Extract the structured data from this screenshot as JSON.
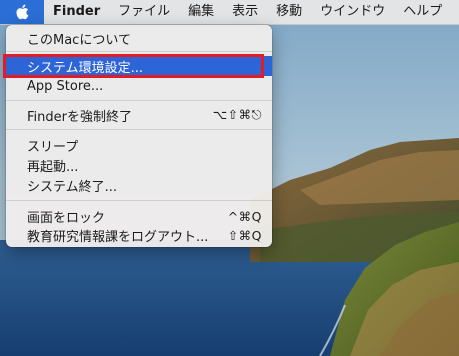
{
  "menubar": {
    "apple_icon": "apple-logo-icon",
    "app_name": "Finder",
    "menus": [
      "ファイル",
      "編集",
      "表示",
      "移動",
      "ウインドウ",
      "ヘルプ"
    ]
  },
  "apple_menu": {
    "items": [
      {
        "label": "このMacについて",
        "shortcut": ""
      },
      {
        "label": "システム環境設定...",
        "shortcut": "",
        "selected": true
      },
      {
        "label": "App Store...",
        "shortcut": ""
      },
      {
        "label": "Finderを強制終了",
        "shortcut": "⌥⇧⌘⎋"
      },
      {
        "label": "スリープ",
        "shortcut": ""
      },
      {
        "label": "再起動...",
        "shortcut": ""
      },
      {
        "label": "システム終了...",
        "shortcut": ""
      },
      {
        "label": "画面をロック",
        "shortcut": "^⌘Q"
      },
      {
        "label": "教育研究情報課をログアウト...",
        "shortcut": "⇧⌘Q"
      }
    ]
  },
  "colors": {
    "selection": "#2d64d8",
    "annotation_border": "#e31b23",
    "apple_menu_active": "#2b6fd6"
  }
}
